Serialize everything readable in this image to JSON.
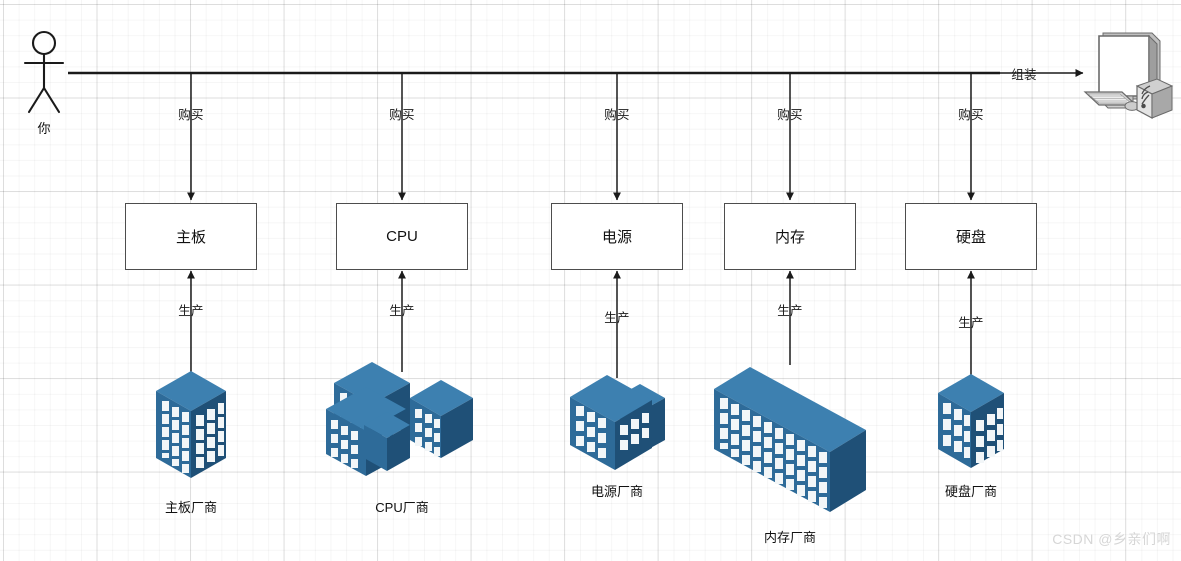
{
  "diagram": {
    "title_watermark": "CSDN @乡亲们啊",
    "actor": {
      "label": "你",
      "icon": "stick-figure-icon"
    },
    "output": {
      "label": "组装",
      "icon": "desktop-computer-icon"
    },
    "colors": {
      "building_front": "#2e6b99",
      "building_side": "#1f5077",
      "building_top": "#3d80b0",
      "window": "#f2f6f8",
      "line": "#1a1a1a",
      "box_border": "#4d4d4d",
      "box_fill": "#ffffff",
      "grid": "#e8e8e8",
      "watermark": "#d6d6d6"
    },
    "buy_label": "购买",
    "make_label": "生产",
    "components": [
      {
        "part": "主板",
        "maker": "主板厂商",
        "buy_label": "购买",
        "make_label": "生产",
        "icon": "office-tower-icon"
      },
      {
        "part": "CPU",
        "maker": "CPU厂商",
        "buy_label": "购买",
        "make_label": "生产",
        "icon": "office-complex-icon"
      },
      {
        "part": "电源",
        "maker": "电源厂商",
        "buy_label": "购买",
        "make_label": "生产",
        "icon": "office-building-icon"
      },
      {
        "part": "内存",
        "maker": "内存厂商",
        "buy_label": "购买",
        "make_label": "生产",
        "icon": "long-factory-icon"
      },
      {
        "part": "硬盘",
        "maker": "硬盘厂商",
        "buy_label": "购买",
        "make_label": "生产",
        "icon": "small-office-icon"
      }
    ]
  }
}
